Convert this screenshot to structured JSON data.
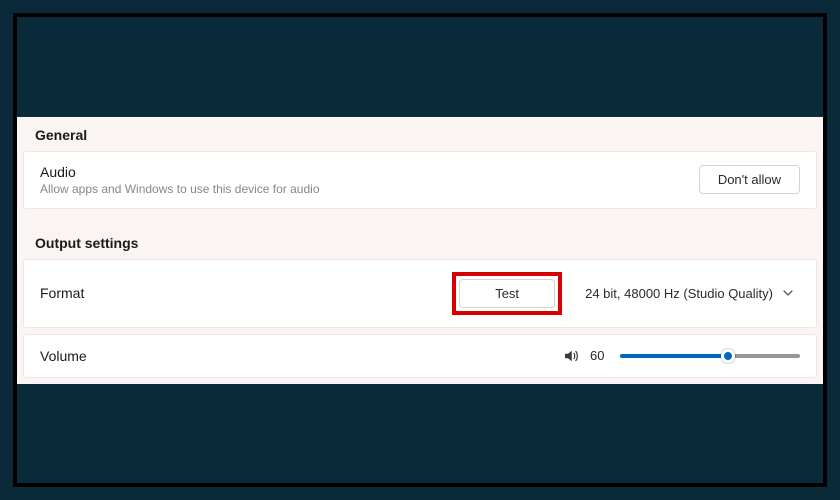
{
  "general": {
    "header": "General",
    "audio": {
      "title": "Audio",
      "subtitle": "Allow apps and Windows to use this device for audio",
      "dont_allow_label": "Don't allow"
    }
  },
  "output": {
    "header": "Output settings",
    "format": {
      "title": "Format",
      "test_label": "Test",
      "selected": "24 bit, 48000 Hz (Studio Quality)"
    },
    "volume": {
      "title": "Volume",
      "value": "60",
      "percent": 60
    }
  }
}
